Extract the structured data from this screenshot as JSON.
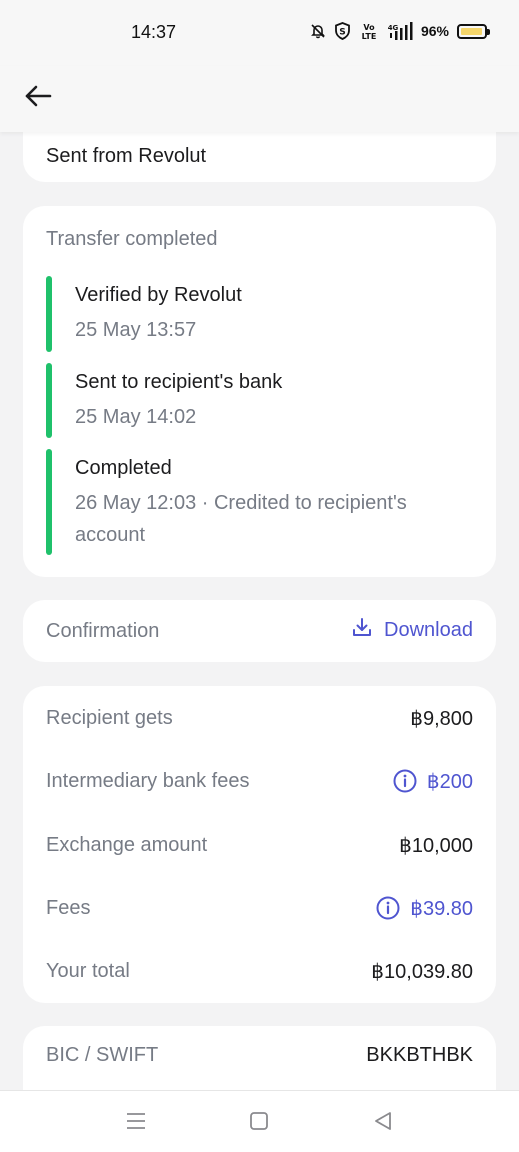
{
  "status_bar": {
    "time": "14:37",
    "volte": "Vo LTE",
    "network": "4G",
    "battery_pct": "96%",
    "battery_level": 0.96,
    "icons": [
      "bell-off-icon",
      "shield-s-icon",
      "volte-icon",
      "signal-icon",
      "battery-icon"
    ]
  },
  "app_bar": {
    "back_icon": "arrow-left-icon"
  },
  "sent_card": {
    "text": "Sent from Revolut"
  },
  "transfer_card": {
    "title": "Transfer completed",
    "steps": [
      {
        "title": "Verified by Revolut",
        "subtitle": "25 May 13:57"
      },
      {
        "title": "Sent to recipient's bank",
        "subtitle": "25 May 14:02"
      },
      {
        "title": "Completed",
        "subtitle": "26 May 12:03 · Credited to recipient's account"
      }
    ],
    "accent_color": "#1fc16b"
  },
  "confirmation_card": {
    "label": "Confirmation",
    "download_label": "Download",
    "download_icon": "download-icon",
    "accent_color": "#4f55d0"
  },
  "details_card": {
    "rows": [
      {
        "label": "Recipient gets",
        "value": "฿9,800"
      },
      {
        "label": "Intermediary bank fees",
        "value": "฿200",
        "info_icon": "info-icon"
      },
      {
        "label": "Exchange amount",
        "value": "฿10,000"
      },
      {
        "label": "Fees",
        "value": "฿39.80",
        "info_icon": "info-icon"
      },
      {
        "label": "Your total",
        "value": "฿10,039.80"
      }
    ]
  },
  "bic_card": {
    "label": "BIC / SWIFT",
    "value": "BKKBTHBK"
  },
  "nav_bar": {
    "icons": [
      "menu-icon",
      "home-square-icon",
      "back-triangle-icon"
    ]
  }
}
